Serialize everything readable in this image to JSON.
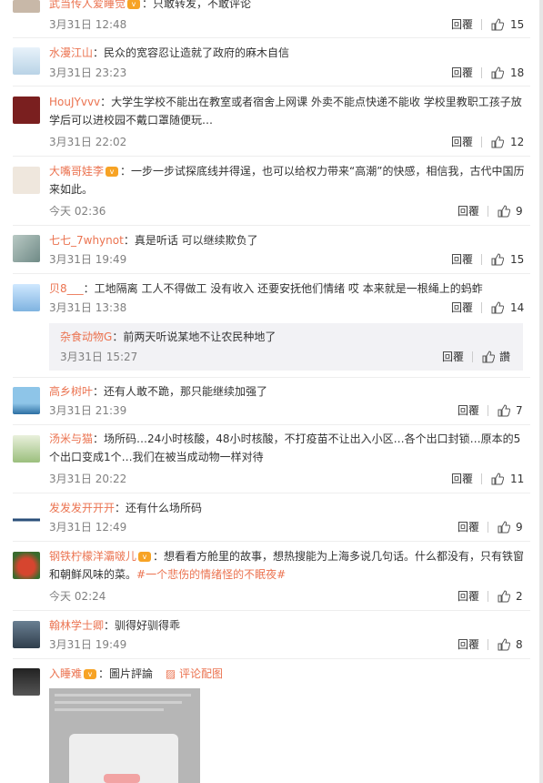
{
  "comments": [
    {
      "user": "武当传人爱睡觉",
      "vip": true,
      "text": "只敢转发，不敢评论",
      "time": "3月31日 12:48",
      "reply": "回覆",
      "likes": "15"
    },
    {
      "user": "水漫江山",
      "vip": false,
      "text": "民众的宽容忍让造就了政府的麻木自信",
      "time": "3月31日 23:23",
      "reply": "回覆",
      "likes": "18"
    },
    {
      "user": "HouJYvvv",
      "vip": false,
      "text": "大学生学校不能出在教室或者宿舍上网课 外卖不能点快递不能收 学校里教职工孩子放学后可以进校园不戴口罩随便玩…",
      "time": "3月31日 22:02",
      "reply": "回覆",
      "likes": "12"
    },
    {
      "user": "大嘴哥娃李",
      "vip": true,
      "text": "一步一步试探底线并得逞，也可以给权力带来“高潮”的快感，相信我，古代中国历来如此。",
      "time": "今天 02:36",
      "reply": "回覆",
      "likes": "9"
    },
    {
      "user": "七七_7whynot",
      "vip": false,
      "text": "真是听话 可以继续欺负了",
      "time": "3月31日 19:49",
      "reply": "回覆",
      "likes": "15"
    },
    {
      "user": "贝8___",
      "vip": false,
      "text": "工地隔离 工人不得做工 没有收入 还要安抚他们情绪 哎 本来就是一根绳上的蚂蚱",
      "time": "3月31日 13:38",
      "reply": "回覆",
      "likes": "14",
      "sub": {
        "user": "杂食动物G",
        "text": "前两天听说某地不让农民种地了",
        "time": "3月31日 15:27",
        "reply": "回覆",
        "likes": "讚"
      }
    },
    {
      "user": "高乡树叶",
      "vip": false,
      "text": "还有人敢不跪，那只能继续加强了",
      "time": "3月31日 21:39",
      "reply": "回覆",
      "likes": "7"
    },
    {
      "user": "汤米与猫",
      "vip": false,
      "text": "场所码…24小时核酸，48小时核酸，不打疫苗不让出入小区…各个出口封锁…原本的5个出口变成1个…我们在被当成动物一样对待",
      "time": "3月31日 20:22",
      "reply": "回覆",
      "likes": "11"
    },
    {
      "user": "发发发开开开",
      "vip": false,
      "text": "还有什么场所码",
      "time": "3月31日 12:49",
      "reply": "回覆",
      "likes": "9"
    },
    {
      "user": "钢铁柠檬洋灞啵儿",
      "vip": true,
      "text": "想看看方舱里的故事，想热搜能为上海多说几句话。什么都没有，只有铁窗和朝鲜风味的菜。",
      "tag": "#一个悲伤的情绪怪的不眠夜#",
      "time": "今天 02:24",
      "reply": "回覆",
      "likes": "2"
    },
    {
      "user": "翰林学士卿",
      "vip": false,
      "text": "驯得好驯得乖",
      "time": "3月31日 19:49",
      "reply": "回覆",
      "likes": "8"
    },
    {
      "user": "入睡难",
      "vip": true,
      "text": "圖片評論",
      "link": "评论配图"
    }
  ],
  "colors": {
    "username": "#eb7350",
    "time": "#808080",
    "subbox": "#f2f2f5"
  }
}
